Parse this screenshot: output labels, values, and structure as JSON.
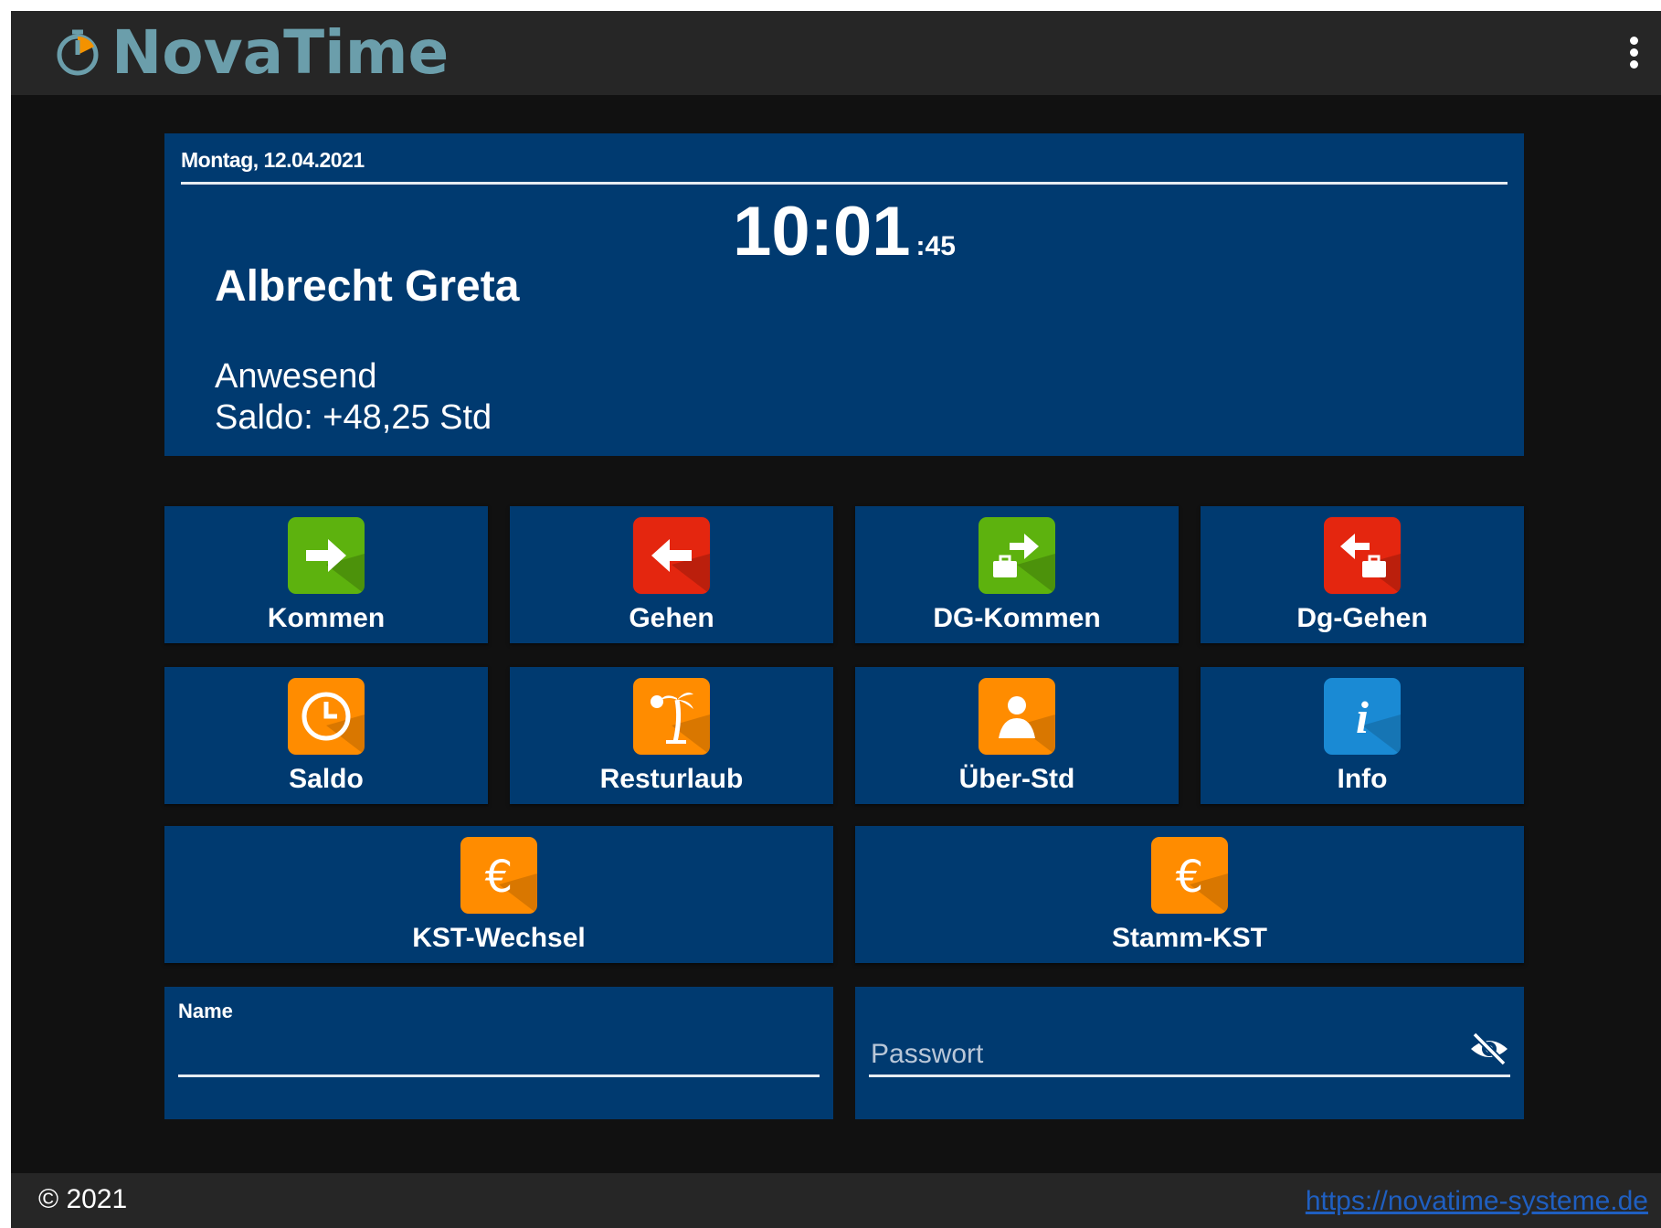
{
  "app": {
    "title": "NovaTime",
    "accent": "#6b9eab",
    "panel_color": "#003a70"
  },
  "header": {
    "logo_text": "NovaTime",
    "logo_icon": "timer-icon",
    "menu_icon": "kebab-menu-icon"
  },
  "status": {
    "date": "Montag, 12.04.2021",
    "time_hm": "10:01",
    "time_sec": ":45",
    "employee": "Albrecht Greta",
    "presence": "Anwesend",
    "balance": "Saldo: +48,25 Std"
  },
  "actions": [
    {
      "label": "Kommen",
      "icon": "arrow-right-icon",
      "color": "#5db20e"
    },
    {
      "label": "Gehen",
      "icon": "arrow-left-icon",
      "color": "#e4260f"
    },
    {
      "label": "DG-Kommen",
      "icon": "business-trip-arrive-icon",
      "color": "#5db20e"
    },
    {
      "label": "Dg-Gehen",
      "icon": "business-trip-leave-icon",
      "color": "#e4260f"
    },
    {
      "label": "Saldo",
      "icon": "clock-icon",
      "color": "#ff8c00"
    },
    {
      "label": "Resturlaub",
      "icon": "palm-tree-icon",
      "color": "#ff8c00"
    },
    {
      "label": "Über-Std",
      "icon": "person-icon",
      "color": "#ff8c00"
    },
    {
      "label": "Info",
      "icon": "info-icon",
      "color": "#1a8ad4"
    },
    {
      "label": "KST-Wechsel",
      "icon": "euro-icon",
      "color": "#ff8c00"
    },
    {
      "label": "Stamm-KST",
      "icon": "euro-icon",
      "color": "#ff8c00"
    }
  ],
  "login": {
    "name_label": "Name",
    "name_value": "",
    "password_placeholder": "Passwort",
    "visibility_icon": "eye-off-icon"
  },
  "footer": {
    "copyright": "© 2021",
    "link": "https://novatime-systeme.de"
  }
}
